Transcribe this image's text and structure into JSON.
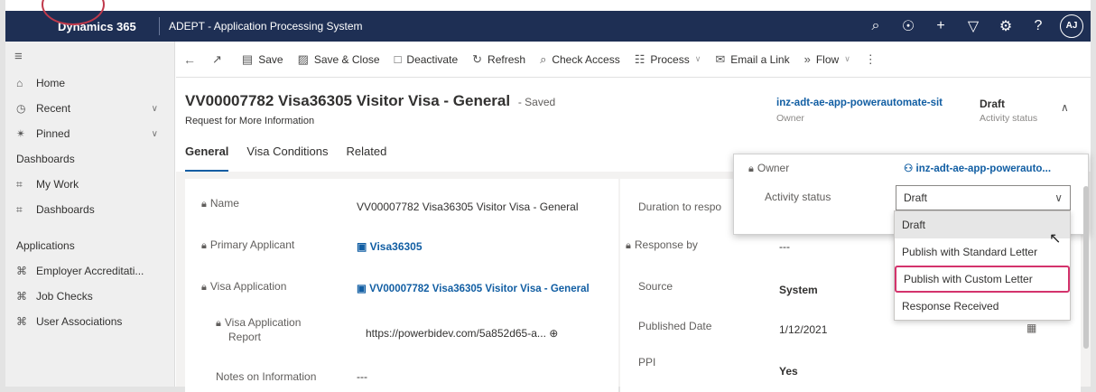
{
  "topbar": {
    "brand": "Dynamics 365",
    "app_title": "ADEPT - Application Processing System",
    "icons": [
      "search-icon",
      "lightbulb-icon",
      "plus-icon",
      "filter-icon",
      "settings-icon",
      "help-icon"
    ],
    "avatar": "AJ"
  },
  "sidebar": {
    "items": [
      {
        "label": "Home",
        "icon": "home-icon"
      },
      {
        "label": "Recent",
        "icon": "recent-icon"
      },
      {
        "label": "Pinned",
        "icon": "pin-icon"
      }
    ],
    "dashboards_header": "Dashboards",
    "dashboard_items": [
      {
        "label": "My Work"
      },
      {
        "label": "Dashboards"
      }
    ],
    "applications_header": "Applications",
    "application_items": [
      {
        "label": "Employer Accreditati..."
      },
      {
        "label": "Job Checks"
      },
      {
        "label": "User Associations"
      }
    ]
  },
  "commandbar": {
    "save": "Save",
    "save_close": "Save & Close",
    "deactivate": "Deactivate",
    "refresh": "Refresh",
    "check_access": "Check Access",
    "process": "Process",
    "email_link": "Email a Link",
    "flow": "Flow"
  },
  "record": {
    "title": "VV00007782 Visa36305 Visitor Visa - General",
    "saved": "- Saved",
    "subtitle": "Request for More Information",
    "owner_value": "inz-adt-ae-app-powerautomate-sit",
    "owner_label": "Owner",
    "status_value": "Draft",
    "status_label": "Activity status"
  },
  "tabs": [
    "General",
    "Visa Conditions",
    "Related"
  ],
  "form_left": {
    "name_label": "Name",
    "name_value": "VV00007782 Visa36305 Visitor Visa - General",
    "primary_label": "Primary Applicant",
    "primary_value": "Visa36305",
    "visa_app_label": "Visa Application",
    "visa_app_value": "VV00007782 Visa36305 Visitor Visa - General",
    "report_label_1": "Visa Application",
    "report_label_2": "Report",
    "report_value": "https://powerbidev.com/5a852d65-a...",
    "notes_label": "Notes on Information",
    "notes_value": "---"
  },
  "form_right": {
    "duration_label": "Duration to respo",
    "response_label": "Response by",
    "response_value": "---",
    "source_label": "Source",
    "source_value": "System",
    "published_label": "Published Date",
    "published_value": "1/12/2021",
    "ppi_label": "PPI",
    "ppi_value": "Yes"
  },
  "popup": {
    "owner_label": "Owner",
    "owner_value": "inz-adt-ae-app-powerauto...",
    "status_label": "Activity status",
    "status_value": "Draft"
  },
  "dropdown": {
    "options": [
      "Draft",
      "Publish with Standard Letter",
      "Publish with Custom Letter",
      "Response Received"
    ]
  }
}
